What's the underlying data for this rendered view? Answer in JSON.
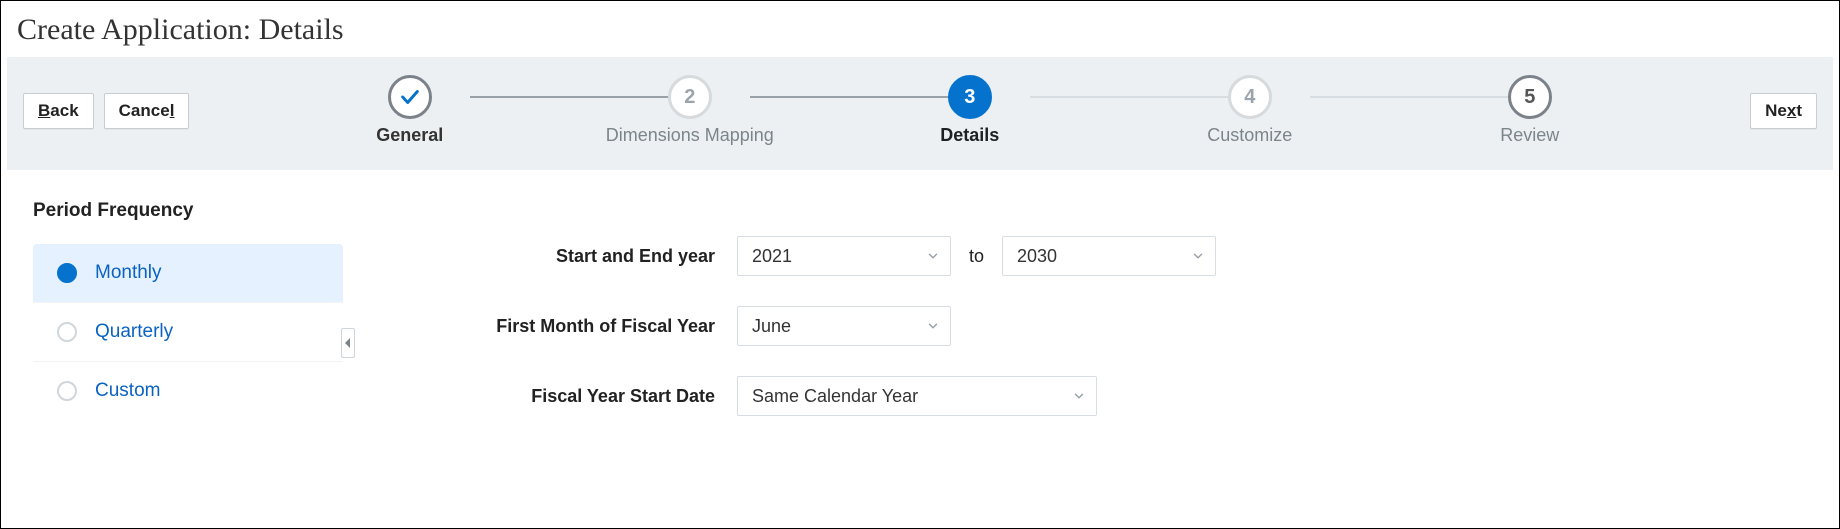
{
  "page": {
    "title": "Create Application: Details"
  },
  "nav": {
    "back": "Back",
    "cancel": "Cancel",
    "next": "Next"
  },
  "steps": [
    {
      "num": "1",
      "label": "General",
      "state": "done"
    },
    {
      "num": "2",
      "label": "Dimensions Mapping",
      "state": "upcoming"
    },
    {
      "num": "3",
      "label": "Details",
      "state": "current"
    },
    {
      "num": "4",
      "label": "Customize",
      "state": "upcoming"
    },
    {
      "num": "5",
      "label": "Review",
      "state": "upcoming"
    }
  ],
  "section": {
    "period_frequency": "Period Frequency"
  },
  "freq_options": [
    {
      "label": "Monthly"
    },
    {
      "label": "Quarterly"
    },
    {
      "label": "Custom"
    }
  ],
  "freq_selected_index": 0,
  "form": {
    "start_end_label": "Start and End year",
    "start_year": "2021",
    "to_label": "to",
    "end_year": "2030",
    "first_month_label": "First Month of Fiscal Year",
    "first_month": "June",
    "fy_start_label": "Fiscal Year Start Date",
    "fy_start": "Same Calendar Year"
  },
  "icons": {
    "chevron_down": "chevron-down-icon",
    "caret_left": "caret-left-icon",
    "check": "check-icon"
  },
  "colors": {
    "accent": "#0572ce",
    "rail_bg": "#ecf0f2",
    "selected_bg": "#e5f1ff",
    "link": "#0a63c2"
  }
}
